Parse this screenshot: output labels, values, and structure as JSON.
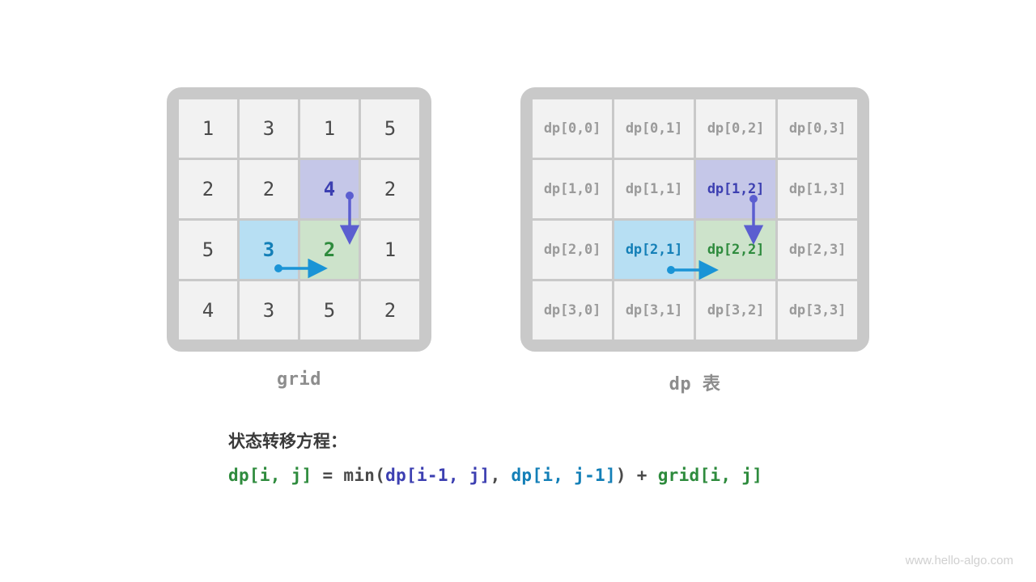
{
  "grid_caption": "grid",
  "dp_caption": "dp 表",
  "grid": [
    [
      "1",
      "3",
      "1",
      "5"
    ],
    [
      "2",
      "2",
      "4",
      "2"
    ],
    [
      "5",
      "3",
      "2",
      "1"
    ],
    [
      "4",
      "3",
      "5",
      "2"
    ]
  ],
  "dp": [
    [
      "dp[0,0]",
      "dp[0,1]",
      "dp[0,2]",
      "dp[0,3]"
    ],
    [
      "dp[1,0]",
      "dp[1,1]",
      "dp[1,2]",
      "dp[1,3]"
    ],
    [
      "dp[2,0]",
      "dp[2,1]",
      "dp[2,2]",
      "dp[2,3]"
    ],
    [
      "dp[3,0]",
      "dp[3,1]",
      "dp[3,2]",
      "dp[3,3]"
    ]
  ],
  "highlight": {
    "purple": [
      1,
      2
    ],
    "blue": [
      2,
      1
    ],
    "green": [
      2,
      2
    ]
  },
  "formula_title": "状态转移方程：",
  "formula": {
    "lhs": "dp[i, j]",
    "eq": " = min(",
    "a": "dp[i-1, j]",
    "sep": ", ",
    "b": "dp[i, j-1]",
    "close": ") + ",
    "g": "grid[i, j]"
  },
  "watermark": "www.hello-algo.com",
  "colors": {
    "purple_bg": "#c5c7e8",
    "blue_bg": "#b7dff3",
    "green_bg": "#cde3cb",
    "purple_fg": "#3c3fb1",
    "blue_fg": "#137fb7",
    "green_fg": "#2e8b3d"
  }
}
